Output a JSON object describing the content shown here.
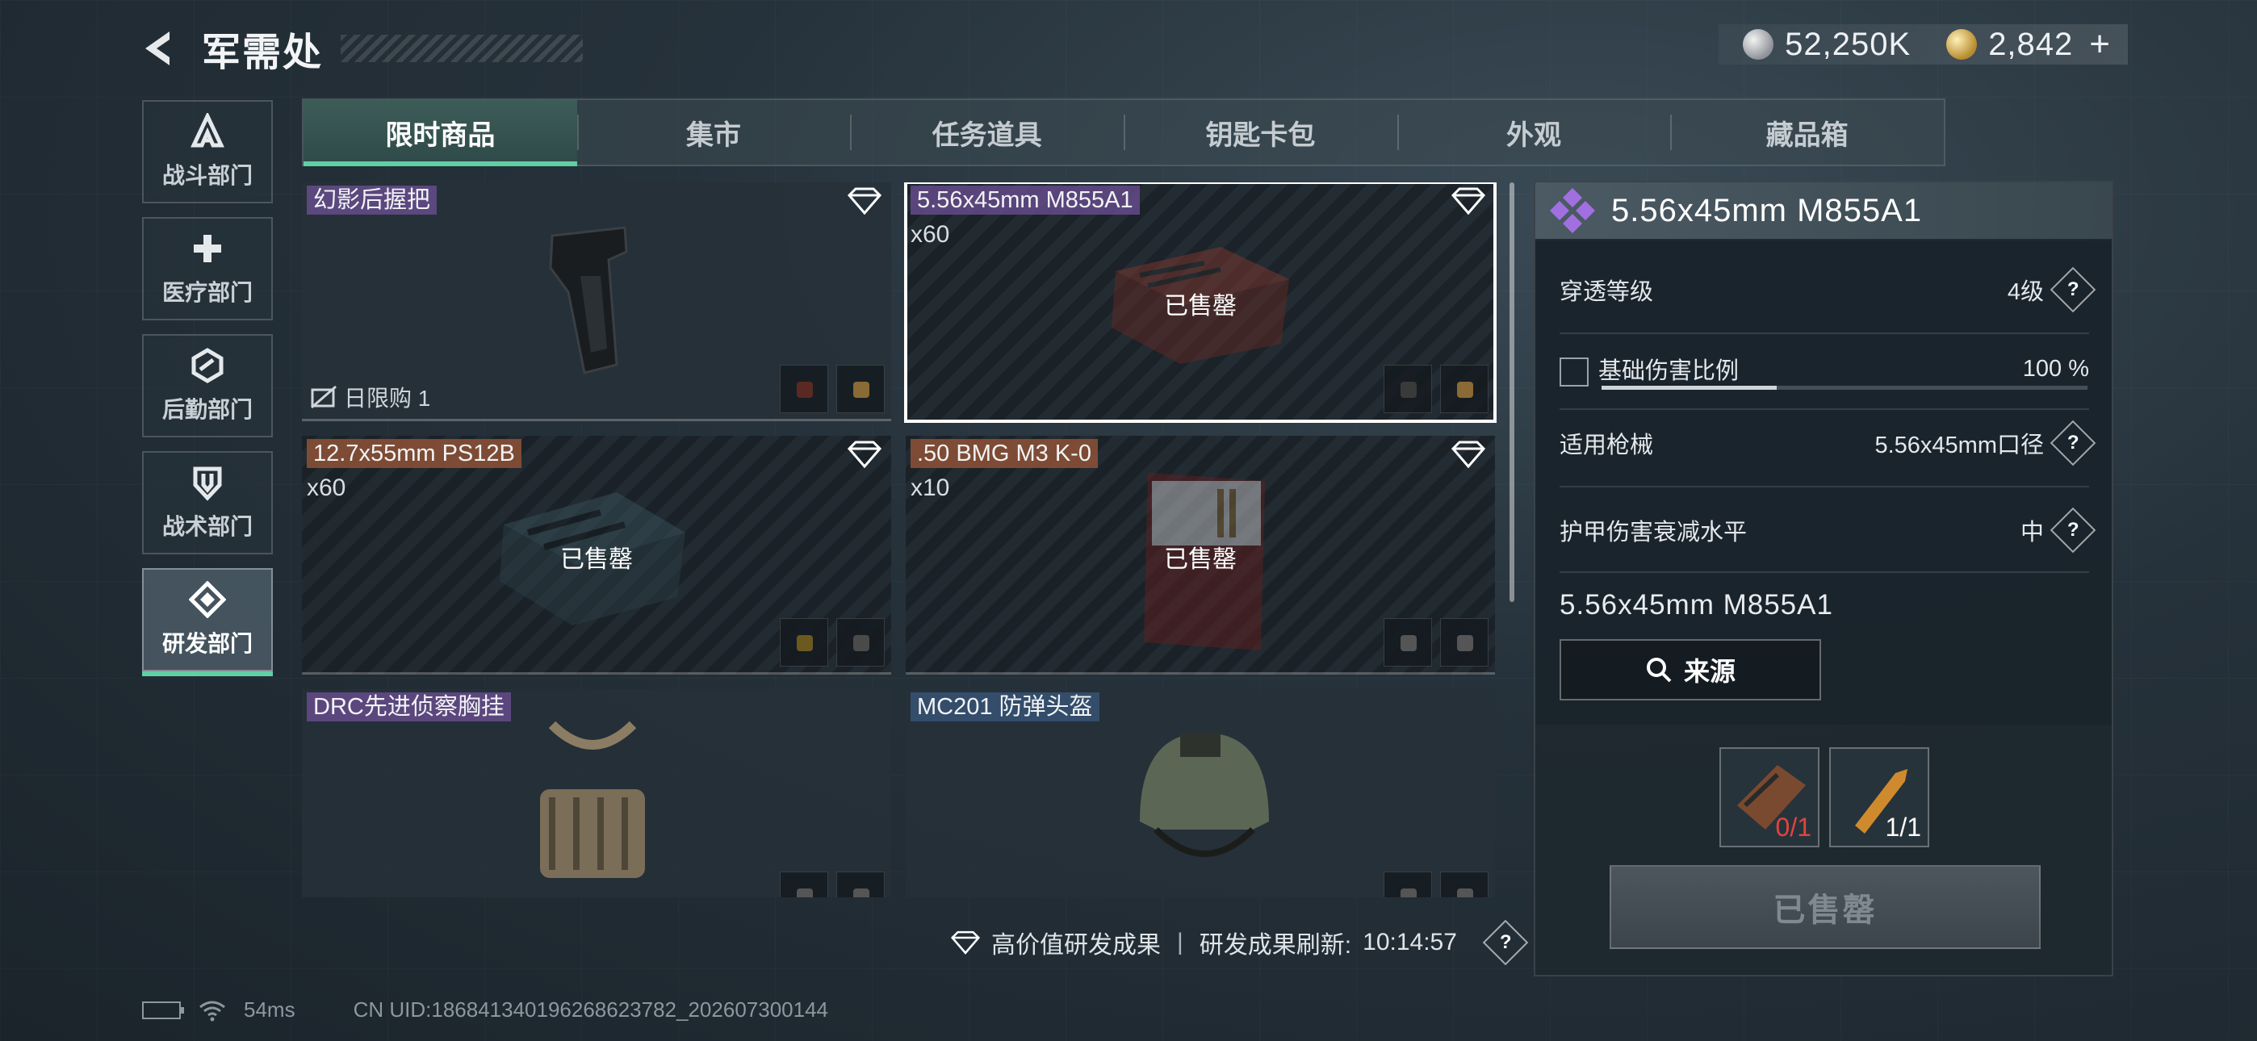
{
  "header": {
    "title": "军需处"
  },
  "currency": {
    "silver": "52,250K",
    "gold": "2,842"
  },
  "sidebar": {
    "items": [
      {
        "label": "战斗部门",
        "icon": "combat-icon"
      },
      {
        "label": "医疗部门",
        "icon": "medical-cross-icon"
      },
      {
        "label": "后勤部门",
        "icon": "logistics-icon"
      },
      {
        "label": "战术部门",
        "icon": "tactical-shield-icon"
      },
      {
        "label": "研发部门",
        "icon": "research-icon",
        "active": true
      }
    ]
  },
  "tabs": [
    {
      "label": "限时商品",
      "active": true
    },
    {
      "label": "集市"
    },
    {
      "label": "任务道具"
    },
    {
      "label": "钥匙卡包"
    },
    {
      "label": "外观"
    },
    {
      "label": "藏品箱"
    }
  ],
  "items": [
    {
      "name": "幻影后握把",
      "limit": "日限购 1",
      "sold": false
    },
    {
      "name": "5.56x45mm M855A1",
      "qty": "x60",
      "sold_label": "已售罄",
      "selected": true
    },
    {
      "name": "12.7x55mm PS12B",
      "qty": "x60",
      "sold_label": "已售罄"
    },
    {
      "name": ".50 BMG M3 K-0",
      "qty": "x10",
      "sold_label": "已售罄"
    },
    {
      "name": "DRC先进侦察胸挂"
    },
    {
      "name": "MC201 防弹头盔"
    }
  ],
  "footer": {
    "high_value": "高价值研发成果",
    "refresh_label": "研发成果刷新:",
    "refresh_time": "10:14:57",
    "ping": "54ms",
    "uid": "CN UID:1868413401962686237​82_202607300144"
  },
  "detail": {
    "name": "5.56x45mm M855A1",
    "penetration_label": "穿透等级",
    "penetration_value": "4级",
    "damage_label": "基础伤害比例",
    "damage_value": "100 %",
    "damage_fill": 0.36,
    "weapon_label": "适用枪械",
    "weapon_value": "5.56x45mm口径",
    "armor_label": "护甲伤害衰减水平",
    "armor_value": "中",
    "item_name": "5.56x45mm M855A1",
    "source_label": "来源",
    "req1_count": "0/1",
    "req2_count": "1/1",
    "buy_label": "已售罄"
  },
  "colors": {
    "accent": "#5fd0a4",
    "insufficient": "#e2443f"
  }
}
